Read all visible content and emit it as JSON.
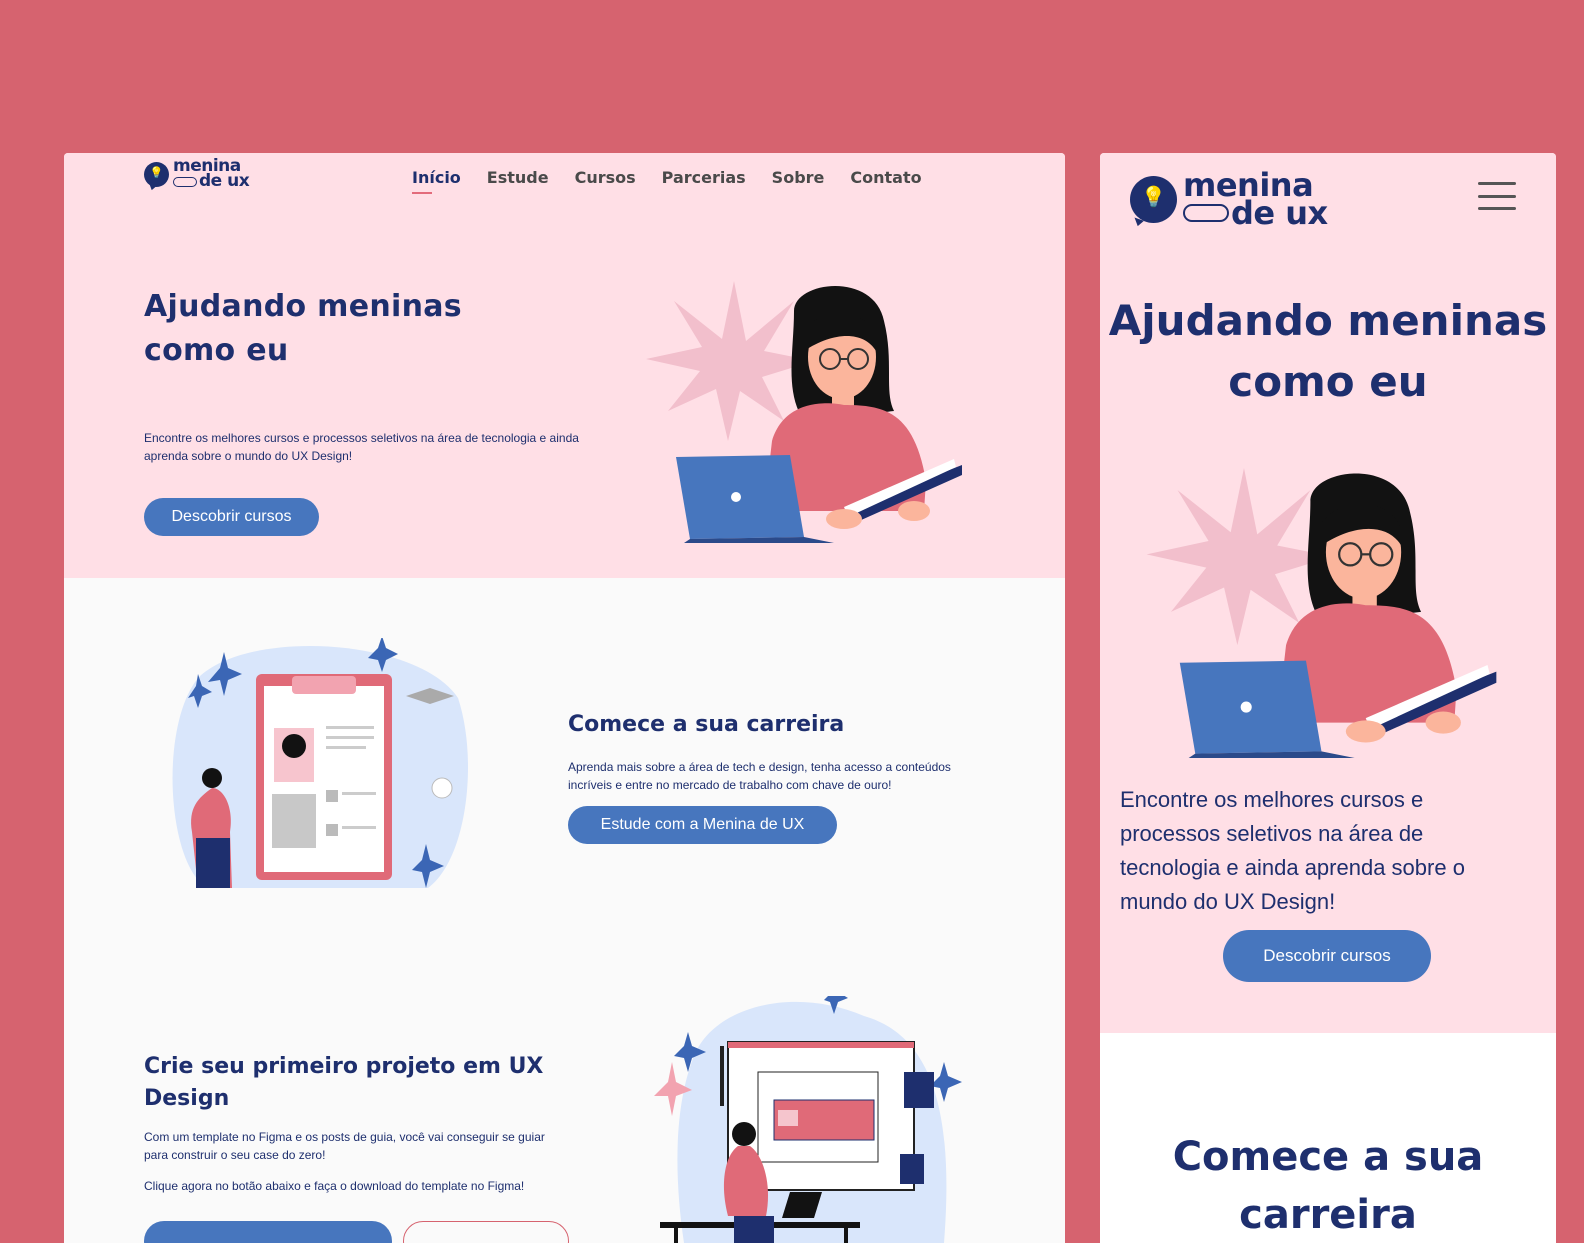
{
  "brand": {
    "line1": "menina",
    "line2": "de ux"
  },
  "nav": [
    "Início",
    "Estude",
    "Cursos",
    "Parcerias",
    "Sobre",
    "Contato"
  ],
  "hero": {
    "title": "Ajudando meninas como eu",
    "text": "Encontre os melhores cursos e processos seletivos na área de tecnologia e ainda aprenda sobre o mundo do UX Design!",
    "button": "Descobrir cursos"
  },
  "career": {
    "title": "Comece a sua carreira",
    "text": "Aprenda mais sobre a área de tech e design, tenha acesso a conteúdos incríveis e entre no mercado de trabalho com chave de ouro!",
    "button": "Estude com a Menina de UX"
  },
  "project": {
    "title": "Crie seu primeiro projeto em UX Design",
    "text1": "Com um template no Figma e os posts de guia, você vai conseguir se guiar para construir o seu case do zero!",
    "text2": "Clique agora no botão abaixo e faça o download do template no Figma!"
  },
  "colors": {
    "background": "#d6636f",
    "hero": "#ffdfe6",
    "navy": "#1e2f6e",
    "button": "#4776be",
    "accent": "#e36b7b"
  },
  "icons": {
    "logo": "lightbulb-icon",
    "menu": "hamburger-menu-icon"
  }
}
